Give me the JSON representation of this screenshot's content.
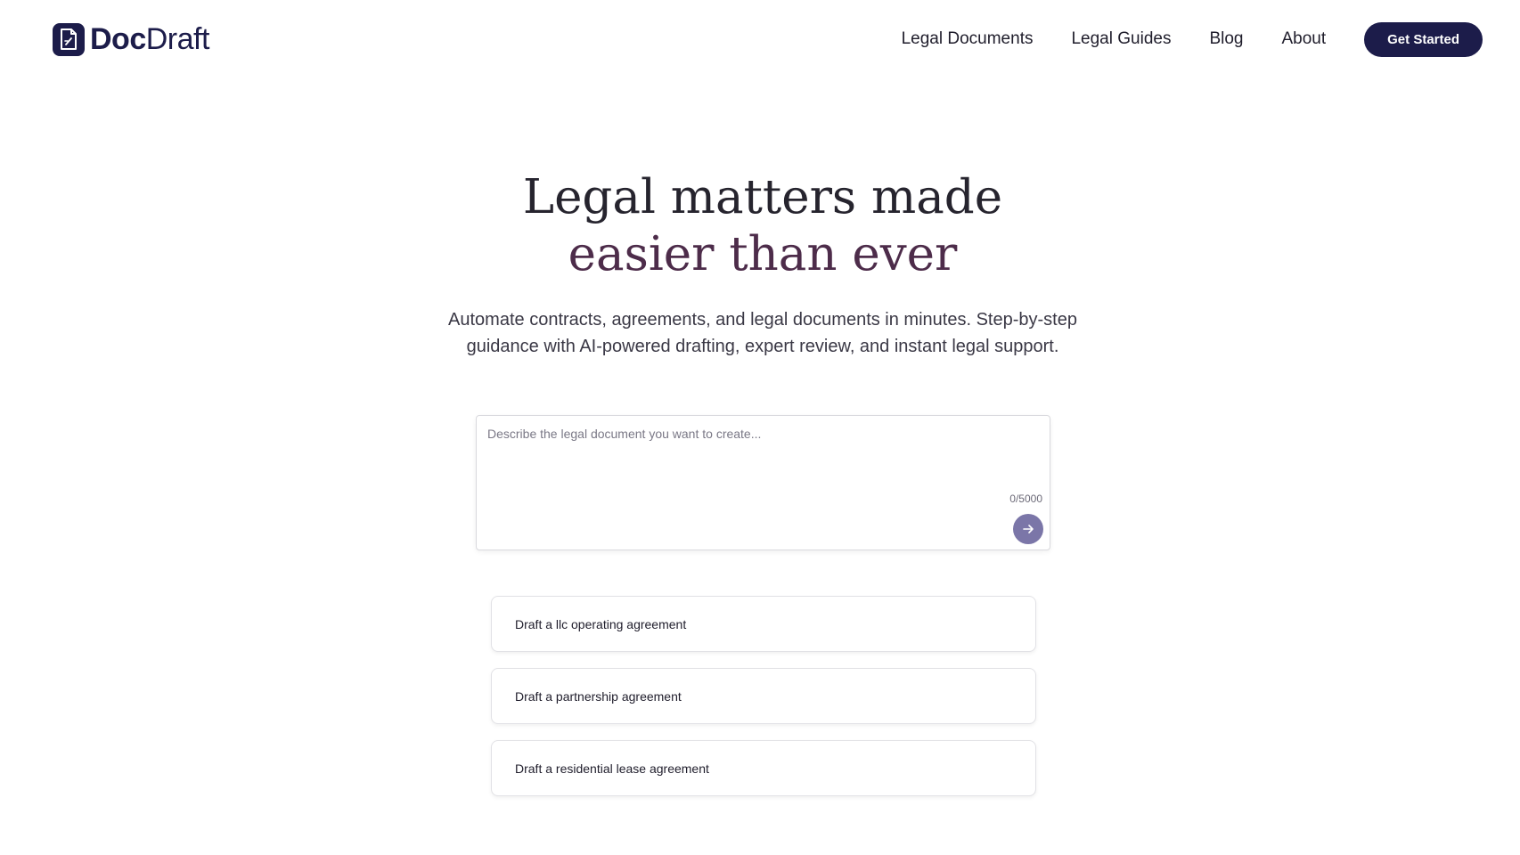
{
  "header": {
    "logo": {
      "bold": "Doc",
      "light": "Draft"
    },
    "nav": [
      "Legal Documents",
      "Legal Guides",
      "Blog",
      "About"
    ],
    "cta_label": "Get Started"
  },
  "hero": {
    "title_line1": "Legal matters made",
    "title_line2": "easier than ever",
    "subtitle": "Automate contracts, agreements, and legal documents in minutes. Step-by-step guidance with AI-powered drafting, expert review, and instant legal support."
  },
  "prompt": {
    "placeholder": "Describe the legal document you want to create...",
    "value": "",
    "char_count": "0/5000",
    "submit_icon": "arrow-right-icon"
  },
  "suggestions": [
    "Draft a llc operating agreement",
    "Draft a partnership agreement",
    "Draft a residential lease agreement"
  ],
  "colors": {
    "brand": "#1c1c4a",
    "accent": "#4d2c4a",
    "submit": "#7b76a8"
  }
}
